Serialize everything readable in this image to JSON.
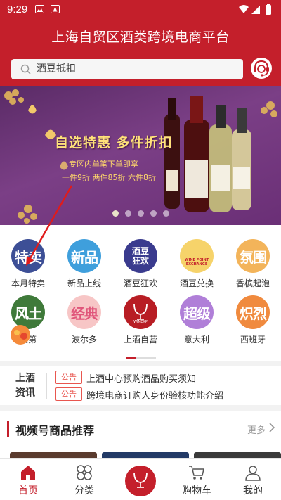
{
  "status_bar": {
    "time": "9:29"
  },
  "header": {
    "title": "上海自贸区酒类跨境电商平台"
  },
  "search": {
    "value": "酒豆抵扣"
  },
  "banner": {
    "headline": "自选特惠 多件折扣",
    "line1": "专区内单笔下单即享",
    "line2": "一件9折 两件85折 六件8折",
    "slide_count": 5,
    "active_slide": 1
  },
  "categories": [
    {
      "badge": "特卖",
      "label": "本月特卖",
      "icon": "sale-badge-icon"
    },
    {
      "badge": "新品",
      "label": "新品上线",
      "icon": "new-badge-icon"
    },
    {
      "badge": "酒豆狂欢",
      "label": "酒豆狂欢",
      "icon": "bean-carnival-icon"
    },
    {
      "badge": "WINE POINT EXCHANGE",
      "label": "酒豆兑换",
      "icon": "point-exchange-icon"
    },
    {
      "badge": "氛围",
      "label": "香槟起泡",
      "icon": "atmosphere-badge-icon"
    },
    {
      "badge": "风土",
      "label": "良第",
      "icon": "terroir-badge-icon"
    },
    {
      "badge": "经典",
      "label": "波尔多",
      "icon": "classic-badge-icon"
    },
    {
      "badge": "WINEXP",
      "label": "上酒自营",
      "icon": "winexp-logo-icon"
    },
    {
      "badge": "超级",
      "label": "意大利",
      "icon": "super-badge-icon"
    },
    {
      "badge": "炽烈",
      "label": "西班牙",
      "icon": "blazing-badge-icon"
    }
  ],
  "news": {
    "title": "上酒资讯",
    "items": [
      {
        "tag": "公告",
        "text": "上酒中心预购酒品购买须知"
      },
      {
        "tag": "公告",
        "text": "跨境电商订购人身份验核功能介绍"
      }
    ]
  },
  "video_section": {
    "title": "视频号商品推荐",
    "more": "更多"
  },
  "tabbar": {
    "tabs": [
      {
        "label": "首页",
        "icon": "home-icon",
        "active": true
      },
      {
        "label": "分类",
        "icon": "category-icon",
        "active": false
      },
      {
        "label": "",
        "icon": "winexp-logo-icon",
        "active": false
      },
      {
        "label": "购物车",
        "icon": "cart-icon",
        "active": false
      },
      {
        "label": "我的",
        "icon": "profile-icon",
        "active": false
      }
    ]
  },
  "colors": {
    "brand": "#c41f2b",
    "tag": "#e8564f"
  }
}
